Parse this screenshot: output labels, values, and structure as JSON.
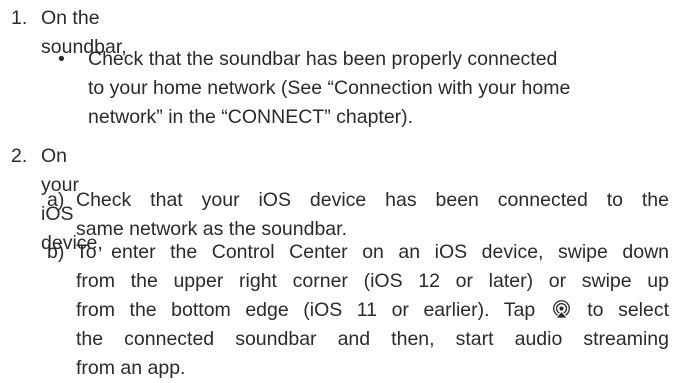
{
  "steps": [
    {
      "number": "1.",
      "heading": "On the soundbar,",
      "bullet_symbol": "•",
      "bullet_lines": [
        "Check that the soundbar has been properly connected",
        "to your home network (See “Connection with your home",
        "network” in the “CONNECT” chapter)."
      ]
    },
    {
      "number": "2.",
      "heading": "On your iOS device,",
      "sub_a": {
        "marker": "a)",
        "lines": [
          "Check that your iOS device has been connected to the",
          "same network as the soundbar."
        ]
      },
      "sub_b": {
        "marker": "b)",
        "line1": "To enter the Control Center on an iOS device, swipe down",
        "line2": "from the upper right corner (iOS 12 or later) or swipe up",
        "line3_before": "from the bottom edge (iOS 11 or earlier). Tap",
        "line3_after": "to select",
        "line4": "the connected soundbar and then, start audio streaming",
        "line5": "from an app."
      }
    }
  ]
}
